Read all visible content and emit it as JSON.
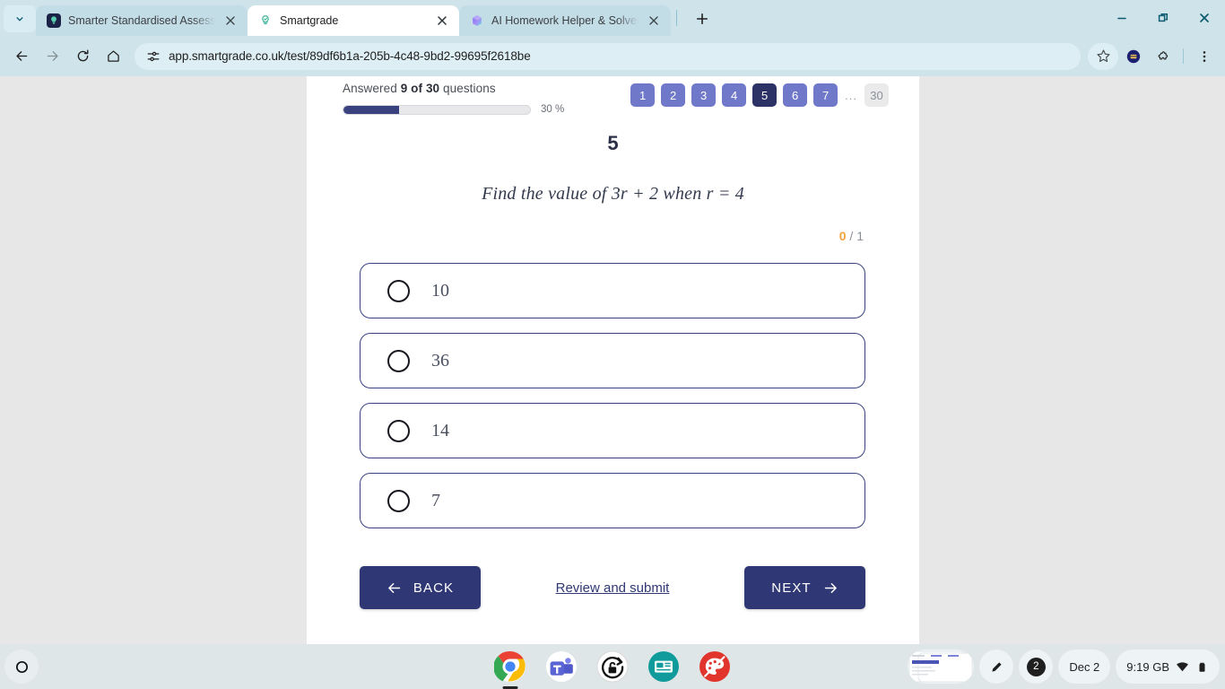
{
  "browser": {
    "tab_search_icon": "chevron-down-icon",
    "tabs": [
      {
        "title": "Smarter Standardised Assessm",
        "favicon": "smartgrade-dark-bulb-icon",
        "active": false
      },
      {
        "title": "Smartgrade",
        "favicon": "smartgrade-bulb-icon",
        "active": true
      },
      {
        "title": "AI Homework Helper & Solver -",
        "favicon": "ai-cube-icon",
        "active": false
      }
    ],
    "new_tab_label": "+",
    "window_controls": [
      "minimize-icon",
      "maximize-icon",
      "close-icon"
    ],
    "nav": {
      "back": "back-arrow-icon",
      "forward": "forward-arrow-icon",
      "reload": "reload-icon",
      "home": "home-icon"
    },
    "omnibox": {
      "site_settings_icon": "tune-icon",
      "url": "app.smartgrade.co.uk/test/89df6b1a-205b-4c48-9bd2-99695f2618be"
    },
    "toolbar_right": {
      "bookmark": "star-icon",
      "profile": "profile-avatar-icon",
      "extensions": "puzzle-piece-icon",
      "menu": "three-dot-menu-icon"
    }
  },
  "quiz": {
    "answered_prefix": "Answered ",
    "answered_count": "9 of 30",
    "answered_suffix": " questions",
    "progress_percent": 30,
    "progress_label": "30 %",
    "question_nav": [
      {
        "label": "1",
        "state": "visited"
      },
      {
        "label": "2",
        "state": "visited"
      },
      {
        "label": "3",
        "state": "visited"
      },
      {
        "label": "4",
        "state": "visited"
      },
      {
        "label": "5",
        "state": "current"
      },
      {
        "label": "6",
        "state": "visited"
      },
      {
        "label": "7",
        "state": "visited"
      }
    ],
    "nav_ellipsis": "...",
    "nav_last": "30",
    "question_number": "5",
    "question_text": "Find the value of 3r + 2 when r = 4",
    "score_earned": "0",
    "score_total": "/ 1",
    "options": [
      {
        "label": "10",
        "selected": false
      },
      {
        "label": "36",
        "selected": false
      },
      {
        "label": "14",
        "selected": false
      },
      {
        "label": "7",
        "selected": false
      }
    ],
    "back_label": "BACK",
    "review_label": "Review and submit",
    "next_label": "NEXT",
    "accent_navy": "#2f3875",
    "accent_pill": "#6f78c9",
    "score_color": "#f0a33c"
  },
  "shelf": {
    "launcher_icon": "launcher-circle-icon",
    "apps": [
      {
        "name": "chrome-icon",
        "running": true
      },
      {
        "name": "microsoft-teams-icon",
        "running": false
      },
      {
        "name": "lock-refresh-icon",
        "running": false
      },
      {
        "name": "news-card-icon",
        "running": false
      },
      {
        "name": "paint-palette-icon",
        "running": false
      }
    ],
    "tray": {
      "window_preview": "window-preview-thumbnail",
      "stylus_icon": "pen-icon",
      "notification_count": "2",
      "date": "Dec 2",
      "time": "9:19 GB",
      "wifi_icon": "wifi-icon",
      "battery_icon": "battery-icon"
    }
  }
}
